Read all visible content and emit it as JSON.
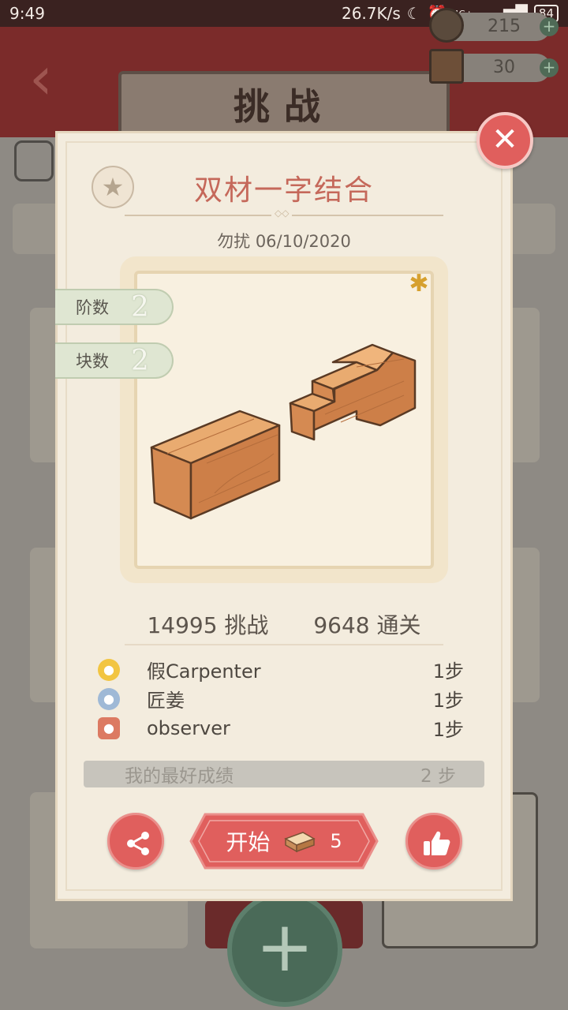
{
  "status_bar": {
    "time": "9:49",
    "network_speed": "26.7K/s",
    "network_type": "4G+",
    "battery": "84"
  },
  "header": {
    "title": "挑战",
    "coins": "215",
    "boxes": "30"
  },
  "puzzle": {
    "title": "双材一字结合",
    "author": "勿扰",
    "date": "06/10/2020",
    "level_label": "阶数",
    "level_value": "2",
    "blocks_label": "块数",
    "blocks_value": "2",
    "challenges": "14995 挑战",
    "clears": "9648 通关"
  },
  "ranking": [
    {
      "player": "假Carpenter",
      "steps": "1步",
      "medal": "gold-medal-icon",
      "color": "#f2c542"
    },
    {
      "player": "匠姜",
      "steps": "1步",
      "medal": "silver-medal-icon",
      "color": "#9fb9d6"
    },
    {
      "player": "observer",
      "steps": "1步",
      "medal": "bronze-medal-icon",
      "color": "#dc7a62"
    }
  ],
  "best": {
    "label": "我的最好成绩",
    "value": "2 步"
  },
  "actions": {
    "start_label": "开始",
    "start_cost": "5"
  },
  "colors": {
    "accent_red": "#e05f5d",
    "title_red": "#c5685a",
    "paper": "#f3ecde",
    "wood": "#d48a52"
  }
}
